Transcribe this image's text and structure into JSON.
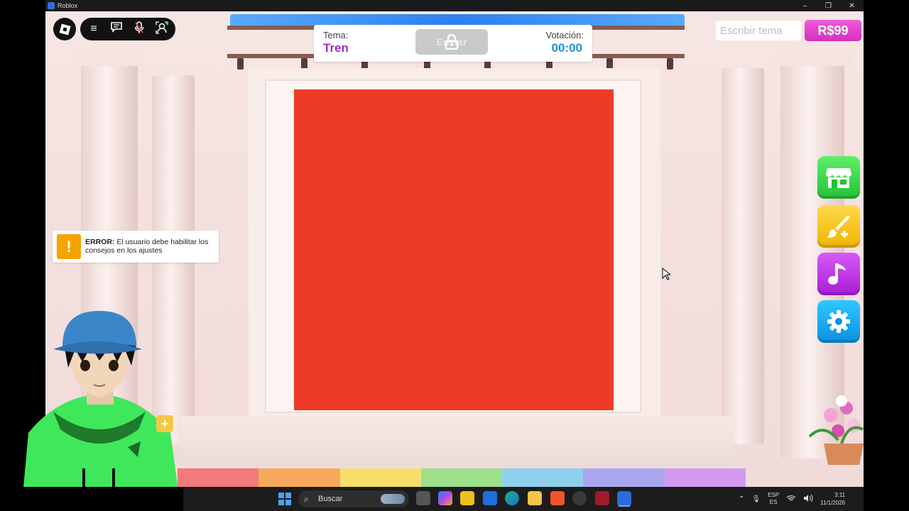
{
  "window": {
    "title": "Roblox",
    "controls": [
      "–",
      "❐",
      "✕"
    ]
  },
  "roblox_menu": {
    "logo_icon": "roblox-logo-icon",
    "icons": [
      "≡",
      "💬",
      "🎤",
      "⚙"
    ]
  },
  "topic_panel": {
    "topic_label": "Tema:",
    "topic_value": "Tren",
    "send_label": "Enviar",
    "vote_label": "Votación:",
    "vote_timer": "00:00"
  },
  "topic_input": {
    "placeholder": "Escribir tema"
  },
  "robux": {
    "label": "R$99"
  },
  "side_buttons": {
    "shop_icon": "shop-icon",
    "paint_icon": "paint-brush-icon",
    "music_icon": "music-note-icon",
    "settings_icon": "gear-icon"
  },
  "error_toast": {
    "icon": "!",
    "prefix": "ERROR:",
    "message": "El usuario debe habilitar los consejos en los ajustes"
  },
  "plus_button": {
    "label": "+"
  },
  "taskbar": {
    "search_label": "Buscar",
    "lang_top": "ESP",
    "lang_bottom": "ES",
    "time": "3:11",
    "date": "11/1/2026"
  },
  "colors": {
    "canvas": "#ee3b27",
    "topic_value": "#9b2cc4",
    "vote_timer": "#1f8fde",
    "robux": "#d72fc0",
    "shop": "#21c234",
    "paint": "#f0b400",
    "music": "#a81cd6",
    "settings": "#0a8fe0",
    "error_icon": "#f5a300"
  }
}
